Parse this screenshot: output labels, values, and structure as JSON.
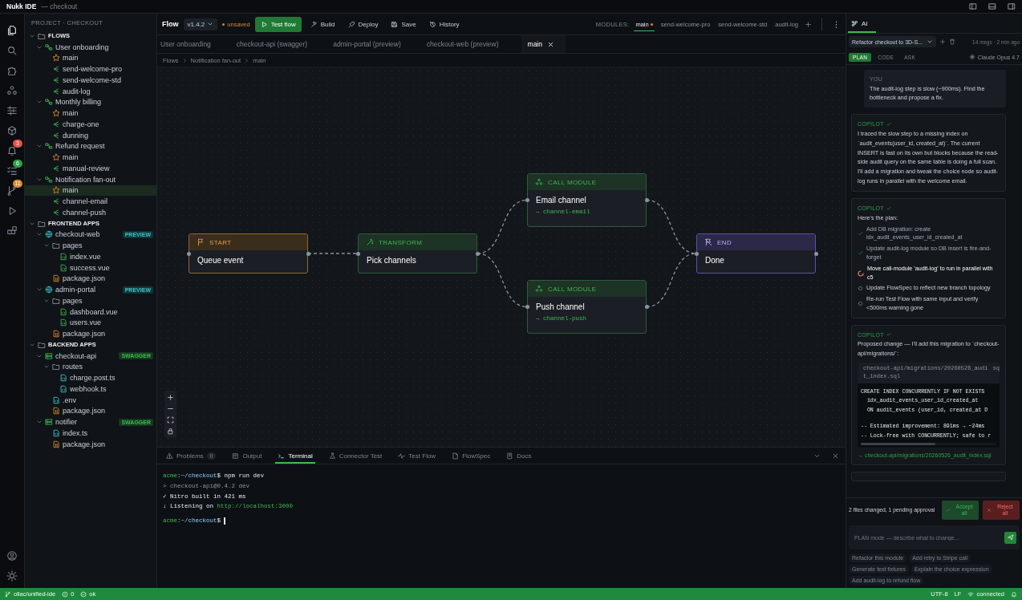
{
  "window": {
    "title": "Nukk IDE",
    "subtitle": "— checkout"
  },
  "activity_bar": [
    {
      "selected": true
    },
    {
      "selected": false
    },
    {
      "selected": false
    },
    {
      "selected": false
    },
    {
      "selected": false
    },
    {
      "selected": false
    },
    {
      "selected": false,
      "badge": "3",
      "color": "#e5534b"
    },
    {
      "selected": false,
      "badge": "6",
      "color": "#2ea043"
    },
    {
      "selected": false,
      "badge": "11",
      "color": "#d98a2b"
    },
    {
      "selected": false
    },
    {
      "selected": false
    }
  ],
  "sidebar": {
    "heading": "PROJECT · CHECKOUT",
    "tree": [
      {
        "label": "FLOWS",
        "kind": "section",
        "selected": false,
        "expanded": true,
        "children": [
          {
            "label": "User onboarding",
            "kind": "flow",
            "selected": false,
            "expanded": true,
            "children": [
              {
                "label": "main",
                "kind": "entry",
                "selected": false
              },
              {
                "label": "send-welcome-pro",
                "kind": "module",
                "selected": false
              },
              {
                "label": "send-welcome-std",
                "kind": "module",
                "selected": false
              },
              {
                "label": "audit-log",
                "kind": "module",
                "selected": false
              }
            ]
          },
          {
            "label": "Monthly billing",
            "kind": "flow",
            "selected": false,
            "expanded": true,
            "children": [
              {
                "label": "main",
                "kind": "entry",
                "selected": false
              },
              {
                "label": "charge-one",
                "kind": "module",
                "selected": false
              },
              {
                "label": "dunning",
                "kind": "module",
                "selected": false
              }
            ]
          },
          {
            "label": "Refund request",
            "kind": "flow",
            "selected": false,
            "expanded": true,
            "children": [
              {
                "label": "main",
                "kind": "entry",
                "selected": false
              },
              {
                "label": "manual-review",
                "kind": "module",
                "selected": false
              }
            ]
          },
          {
            "label": "Notification fan-out",
            "kind": "flow",
            "selected": false,
            "expanded": true,
            "children": [
              {
                "label": "main",
                "kind": "entry",
                "selected": true
              },
              {
                "label": "channel-email",
                "kind": "module",
                "selected": false
              },
              {
                "label": "channel-push",
                "kind": "module",
                "selected": false
              }
            ]
          }
        ]
      },
      {
        "label": "FRONTEND APPS",
        "kind": "section",
        "selected": false,
        "expanded": true,
        "children": [
          {
            "label": "checkout-web",
            "kind": "web",
            "selected": false,
            "expanded": true,
            "badge": {
              "text": "PREVIEW",
              "kind": "preview"
            },
            "children": [
              {
                "label": "pages",
                "kind": "folder",
                "selected": false,
                "expanded": true,
                "children": [
                  {
                    "label": "index.vue",
                    "kind": "vue",
                    "selected": false
                  },
                  {
                    "label": "success.vue",
                    "kind": "vue",
                    "selected": false
                  }
                ]
              },
              {
                "label": "package.json",
                "kind": "json",
                "selected": false
              }
            ]
          },
          {
            "label": "admin-portal",
            "kind": "web",
            "selected": false,
            "expanded": true,
            "badge": {
              "text": "PREVIEW",
              "kind": "preview"
            },
            "children": [
              {
                "label": "pages",
                "kind": "folder",
                "selected": false,
                "expanded": true,
                "children": [
                  {
                    "label": "dashboard.vue",
                    "kind": "vue",
                    "selected": false
                  },
                  {
                    "label": "users.vue",
                    "kind": "vue",
                    "selected": false
                  }
                ]
              },
              {
                "label": "package.json",
                "kind": "json",
                "selected": false
              }
            ]
          }
        ]
      },
      {
        "label": "BACKEND APPS",
        "kind": "section",
        "selected": false,
        "expanded": true,
        "children": [
          {
            "label": "checkout-api",
            "kind": "api",
            "selected": false,
            "expanded": true,
            "badge": {
              "text": "SWAGGER",
              "kind": "swagger"
            },
            "children": [
              {
                "label": "routes",
                "kind": "folder",
                "selected": false,
                "expanded": true,
                "children": [
                  {
                    "label": "charge.post.ts",
                    "kind": "ts",
                    "selected": false
                  },
                  {
                    "label": "webhook.ts",
                    "kind": "ts",
                    "selected": false
                  }
                ]
              },
              {
                "label": ".env",
                "kind": "ts",
                "selected": false
              },
              {
                "label": "package.json",
                "kind": "json",
                "selected": false
              }
            ]
          },
          {
            "label": "notifier",
            "kind": "api",
            "selected": false,
            "expanded": true,
            "badge": {
              "text": "SWAGGER",
              "kind": "swagger"
            },
            "children": [
              {
                "label": "index.ts",
                "kind": "ts",
                "selected": false
              },
              {
                "label": "package.json",
                "kind": "json",
                "selected": false
              }
            ]
          }
        ]
      }
    ]
  },
  "toolbar": {
    "title": "Flow",
    "version": "v1.4.2",
    "status": "unsaved",
    "actions": [
      {
        "label": "Test flow",
        "kind": "primary"
      },
      {
        "label": "Build",
        "kind": "plain"
      },
      {
        "label": "Deploy",
        "kind": "plain"
      },
      {
        "label": "Save",
        "kind": "plain"
      },
      {
        "label": "History",
        "kind": "plain"
      }
    ],
    "modules_label": "MODULES:",
    "modules": [
      {
        "label": "main",
        "selected": true,
        "modified": true
      },
      {
        "label": "send-welcome-pro",
        "selected": false,
        "modified": false
      },
      {
        "label": "send-welcome-std",
        "selected": false,
        "modified": false
      },
      {
        "label": "audit-log",
        "selected": false,
        "modified": false
      }
    ]
  },
  "editor_tabs": [
    {
      "label": "User onboarding",
      "selected": false,
      "closable": false
    },
    {
      "label": "checkout-api (swagger)",
      "selected": false,
      "closable": false
    },
    {
      "label": "admin-portal (preview)",
      "selected": false,
      "closable": false
    },
    {
      "label": "checkout-web (preview)",
      "selected": false,
      "closable": false
    },
    {
      "label": "main",
      "selected": true,
      "closable": true
    }
  ],
  "breadcrumb": [
    "Flows",
    "Notification fan-out",
    "main"
  ],
  "canvas": {
    "columns": [
      [
        {
          "kind": "start",
          "header": "START",
          "title": "Queue event"
        }
      ],
      [
        {
          "kind": "transform",
          "header": "TRANSFORM",
          "title": "Pick channels"
        }
      ],
      [
        {
          "kind": "call",
          "header": "CALL MODULE",
          "title": "Email channel",
          "target": "→ channel-email"
        },
        {
          "kind": "call",
          "header": "CALL MODULE",
          "title": "Push channel",
          "target": "→ channel-push"
        }
      ],
      [
        {
          "kind": "end",
          "header": "END",
          "title": "Done"
        }
      ]
    ]
  },
  "panel": {
    "tabs": [
      {
        "label": "Problems",
        "count": "0",
        "selected": false
      },
      {
        "label": "Output",
        "selected": false
      },
      {
        "label": "Terminal",
        "selected": true
      },
      {
        "label": "Connector Test",
        "selected": false
      },
      {
        "label": "Test Flow",
        "selected": false
      },
      {
        "label": "FlowSpec",
        "selected": false
      },
      {
        "label": "Docs",
        "selected": false
      }
    ],
    "terminal": [
      {
        "cursor": false,
        "segments": [
          {
            "text": "acme",
            "kind": "host"
          },
          {
            "text": ":~/checkout",
            "kind": "path"
          },
          {
            "text": "$ npm run dev",
            "kind": "plain"
          }
        ]
      },
      {
        "cursor": false,
        "segments": [
          {
            "text": "> checkout-api@0.4.2 dev",
            "kind": "dim"
          }
        ]
      },
      {
        "cursor": false,
        "segments": [
          {
            "text": "✓ Nitro built in 421 ms",
            "kind": "plain"
          }
        ]
      },
      {
        "cursor": false,
        "segments": [
          {
            "text": "↓ Listening on ",
            "kind": "plain"
          },
          {
            "text": "http://localhost:3000",
            "kind": "link"
          }
        ]
      },
      {
        "cursor": true,
        "segments": [
          {
            "text": "acme",
            "kind": "host"
          },
          {
            "text": ":~/checkout",
            "kind": "path"
          },
          {
            "text": "$",
            "kind": "plain"
          }
        ]
      }
    ]
  },
  "assistant": {
    "tab": "AI",
    "session": "Refactor checkout to 3D-S...",
    "meta": "14 msgs · 2 min ago",
    "modes": [
      {
        "label": "PLAN",
        "selected": true
      },
      {
        "label": "CODE",
        "selected": false
      },
      {
        "label": "ASK",
        "selected": false
      }
    ],
    "model": "Claude Opus 4.7",
    "messages": [
      {
        "kind": "user",
        "author": "YOU",
        "text": "The audit-log step is slow (~900ms). Find the bottleneck and propose a fix."
      },
      {
        "kind": "reply",
        "author": "COPILOT",
        "verified": true,
        "text": "I traced the slow step to a missing index on `audit_events(user_id, created_at)`. The current INSERT is fast on its own but blocks because the read-side audit query on the same table is doing a full scan. I'll add a migration and tweak the choice node so audit-log runs in parallel with the welcome email."
      },
      {
        "kind": "plan",
        "author": "COPILOT",
        "verified": true,
        "text": "Here's the plan:",
        "steps": [
          {
            "text": "Add DB migration: create idx_audit_events_user_id_created_at",
            "done": true,
            "active": false
          },
          {
            "text": "Update audit-log module so DB insert is fire-and-forget",
            "done": true,
            "active": false
          },
          {
            "text": "Move call-module 'audit-log' to run in parallel with c5",
            "done": false,
            "active": true
          },
          {
            "text": "Update FlowSpec to reflect new branch topology",
            "done": false,
            "active": false
          },
          {
            "text": "Re-run Test Flow with same input and verify <500ms warning gone",
            "done": false,
            "active": false
          }
        ]
      },
      {
        "kind": "change",
        "author": "COPILOT",
        "verified": true,
        "text": "Proposed change — I'll add this migration to `checkout-api/migrations/`:",
        "file": "checkout-api/migrations/20260526_audit_index.sql",
        "lang": "sq",
        "code": [
          [
            "CREATE INDEX CONCURRENTLY IF NOT EXISTS",
            "  idx_audit_events_user_id_created_at",
            "  ON audit_events (user_id, created_at D"
          ],
          [
            "-- Estimated improvement: 891ms → ~24ms",
            "-- Lock-free with CONCURRENTLY; safe to r"
          ]
        ],
        "link": "→ checkout-api/migrations/20260526_audit_index.sql"
      }
    ],
    "approval": {
      "summary": "2 files changed, 1 pending approval",
      "accept": "Accept all",
      "reject": "Reject all"
    },
    "input": {
      "placeholder": "PLAN mode — describe what to change..."
    },
    "suggestions": [
      "Refactor this module",
      "Add retry to Stripe call",
      "Generate test fixtures",
      "Explain the choice expression",
      "Add audit-log to refund flow"
    ]
  },
  "status_bar": {
    "branch": "ollac/unified-ide",
    "errors": "0",
    "health": "ok",
    "encoding": "UTF-8",
    "eol": "LF",
    "connection": "connected"
  }
}
